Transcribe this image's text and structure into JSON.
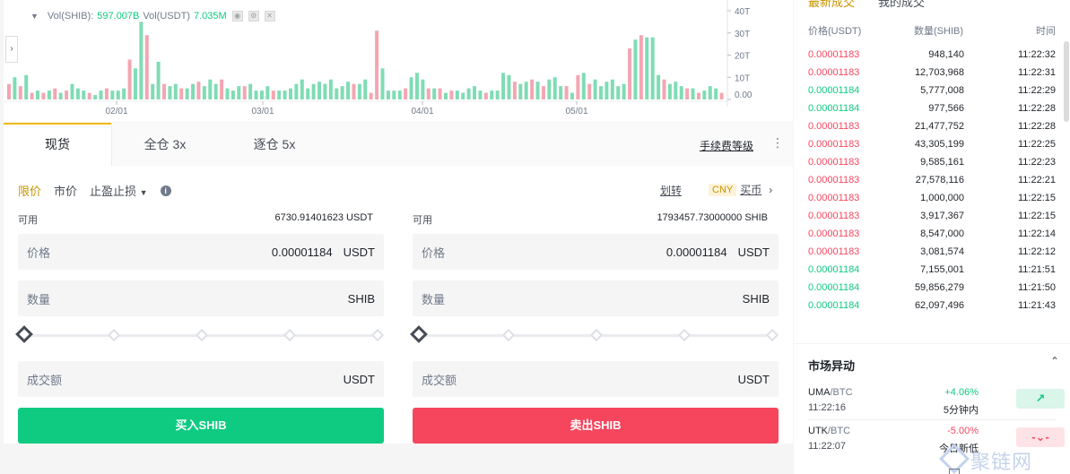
{
  "chart": {
    "legend_vol_shib_label": "Vol(SHIB):",
    "legend_vol_shib_value": "597.007B",
    "legend_vol_usdt_label": "Vol(USDT)",
    "legend_vol_usdt_value": "7.035M",
    "y_ticks": [
      "40T",
      "30T",
      "20T",
      "10T",
      "0.00"
    ],
    "x_ticks": [
      "02/01",
      "03/01",
      "04/01",
      "05/01"
    ],
    "colors": {
      "up": "#0ecb81",
      "down": "#f6465d",
      "up_bar": "#7fdcb4",
      "down_bar": "#f3a6b1"
    }
  },
  "chart_data": {
    "type": "bar",
    "ylim": [
      0,
      40
    ],
    "y_unit": "T",
    "x_ticks": [
      "02/01",
      "03/01",
      "04/01",
      "05/01"
    ],
    "values": [
      {
        "v": 7,
        "d": "down"
      },
      {
        "v": 10,
        "d": "up"
      },
      {
        "v": 6,
        "d": "down"
      },
      {
        "v": 11,
        "d": "up"
      },
      {
        "v": 3,
        "d": "down"
      },
      {
        "v": 4,
        "d": "up"
      },
      {
        "v": 3,
        "d": "down"
      },
      {
        "v": 4,
        "d": "up"
      },
      {
        "v": 5,
        "d": "down"
      },
      {
        "v": 3,
        "d": "up"
      },
      {
        "v": 4,
        "d": "down"
      },
      {
        "v": 7,
        "d": "up"
      },
      {
        "v": 5,
        "d": "up"
      },
      {
        "v": 4,
        "d": "up"
      },
      {
        "v": 3,
        "d": "down"
      },
      {
        "v": 2,
        "d": "up"
      },
      {
        "v": 4,
        "d": "up"
      },
      {
        "v": 5,
        "d": "down"
      },
      {
        "v": 4,
        "d": "up"
      },
      {
        "v": 4,
        "d": "up"
      },
      {
        "v": 5,
        "d": "up"
      },
      {
        "v": 18,
        "d": "down"
      },
      {
        "v": 14,
        "d": "up"
      },
      {
        "v": 35,
        "d": "up"
      },
      {
        "v": 29,
        "d": "down"
      },
      {
        "v": 7,
        "d": "up"
      },
      {
        "v": 17,
        "d": "up"
      },
      {
        "v": 7,
        "d": "down"
      },
      {
        "v": 6,
        "d": "up"
      },
      {
        "v": 7,
        "d": "up"
      },
      {
        "v": 5,
        "d": "down"
      },
      {
        "v": 5,
        "d": "up"
      },
      {
        "v": 7,
        "d": "up"
      },
      {
        "v": 8,
        "d": "down"
      },
      {
        "v": 6,
        "d": "up"
      },
      {
        "v": 9,
        "d": "up"
      },
      {
        "v": 7,
        "d": "up"
      },
      {
        "v": 9,
        "d": "down"
      },
      {
        "v": 5,
        "d": "up"
      },
      {
        "v": 4,
        "d": "up"
      },
      {
        "v": 6,
        "d": "up"
      },
      {
        "v": 6,
        "d": "down"
      },
      {
        "v": 7,
        "d": "up"
      },
      {
        "v": 4,
        "d": "up"
      },
      {
        "v": 4,
        "d": "up"
      },
      {
        "v": 6,
        "d": "up"
      },
      {
        "v": 4,
        "d": "down"
      },
      {
        "v": 4,
        "d": "up"
      },
      {
        "v": 4,
        "d": "up"
      },
      {
        "v": 5,
        "d": "up"
      },
      {
        "v": 7,
        "d": "up"
      },
      {
        "v": 9,
        "d": "up"
      },
      {
        "v": 5,
        "d": "up"
      },
      {
        "v": 7,
        "d": "up"
      },
      {
        "v": 8,
        "d": "up"
      },
      {
        "v": 7,
        "d": "up"
      },
      {
        "v": 9,
        "d": "up"
      },
      {
        "v": 5,
        "d": "up"
      },
      {
        "v": 6,
        "d": "up"
      },
      {
        "v": 8,
        "d": "up"
      },
      {
        "v": 7,
        "d": "down"
      },
      {
        "v": 7,
        "d": "up"
      },
      {
        "v": 9,
        "d": "up"
      },
      {
        "v": 3,
        "d": "down"
      },
      {
        "v": 31,
        "d": "down"
      },
      {
        "v": 14,
        "d": "up"
      },
      {
        "v": 4,
        "d": "up"
      },
      {
        "v": 4,
        "d": "up"
      },
      {
        "v": 4,
        "d": "up"
      },
      {
        "v": 5,
        "d": "down"
      },
      {
        "v": 10,
        "d": "up"
      },
      {
        "v": 12,
        "d": "up"
      },
      {
        "v": 9,
        "d": "up"
      },
      {
        "v": 5,
        "d": "down"
      },
      {
        "v": 5,
        "d": "up"
      },
      {
        "v": 5,
        "d": "down"
      },
      {
        "v": 3,
        "d": "up"
      },
      {
        "v": 4,
        "d": "down"
      },
      {
        "v": 4,
        "d": "up"
      },
      {
        "v": 3,
        "d": "up"
      },
      {
        "v": 5,
        "d": "up"
      },
      {
        "v": 6,
        "d": "up"
      },
      {
        "v": 4,
        "d": "up"
      },
      {
        "v": 3,
        "d": "down"
      },
      {
        "v": 4,
        "d": "up"
      },
      {
        "v": 4,
        "d": "up"
      },
      {
        "v": 12,
        "d": "up"
      },
      {
        "v": 11,
        "d": "up"
      },
      {
        "v": 8,
        "d": "down"
      },
      {
        "v": 7,
        "d": "up"
      },
      {
        "v": 8,
        "d": "up"
      },
      {
        "v": 9,
        "d": "down"
      },
      {
        "v": 8,
        "d": "up"
      },
      {
        "v": 6,
        "d": "down"
      },
      {
        "v": 9,
        "d": "up"
      },
      {
        "v": 10,
        "d": "up"
      },
      {
        "v": 6,
        "d": "up"
      },
      {
        "v": 6,
        "d": "down"
      },
      {
        "v": 3,
        "d": "up"
      },
      {
        "v": 11,
        "d": "down"
      },
      {
        "v": 12,
        "d": "up"
      },
      {
        "v": 7,
        "d": "down"
      },
      {
        "v": 9,
        "d": "up"
      },
      {
        "v": 6,
        "d": "up"
      },
      {
        "v": 8,
        "d": "up"
      },
      {
        "v": 9,
        "d": "up"
      },
      {
        "v": 6,
        "d": "up"
      },
      {
        "v": 7,
        "d": "up"
      },
      {
        "v": 23,
        "d": "down"
      },
      {
        "v": 27,
        "d": "up"
      },
      {
        "v": 29,
        "d": "down"
      },
      {
        "v": 28,
        "d": "up"
      },
      {
        "v": 28,
        "d": "up"
      },
      {
        "v": 11,
        "d": "up"
      },
      {
        "v": 9,
        "d": "down"
      },
      {
        "v": 7,
        "d": "up"
      },
      {
        "v": 8,
        "d": "up"
      },
      {
        "v": 6,
        "d": "up"
      },
      {
        "v": 5,
        "d": "down"
      },
      {
        "v": 5,
        "d": "up"
      },
      {
        "v": 3,
        "d": "down"
      },
      {
        "v": 4,
        "d": "up"
      },
      {
        "v": 6,
        "d": "up"
      },
      {
        "v": 5,
        "d": "up"
      },
      {
        "v": 3,
        "d": "down"
      }
    ]
  },
  "order": {
    "tabs": [
      "现货",
      "全仓 3x",
      "逐仓 5x"
    ],
    "fee_link": "手续费等级",
    "types": [
      "限价",
      "市价",
      "止盈止损"
    ],
    "transfer": "划转",
    "cny_badge": "CNY",
    "buy_coin": "买币",
    "buy": {
      "avail_label": "可用",
      "avail_value": "6730.91401623 USDT",
      "price_label": "价格",
      "price_value": "0.00001184",
      "price_unit": "USDT",
      "qty_label": "数量",
      "qty_unit": "SHIB",
      "slider_percent": 0,
      "total_label": "成交额",
      "total_unit": "USDT",
      "button": "买入SHIB"
    },
    "sell": {
      "avail_label": "可用",
      "avail_value": "1793457.73000000 SHIB",
      "price_label": "价格",
      "price_value": "0.00001184",
      "price_unit": "USDT",
      "qty_label": "数量",
      "qty_unit": "SHIB",
      "slider_percent": 0,
      "total_label": "成交额",
      "total_unit": "USDT",
      "button": "卖出SHIB"
    }
  },
  "trades": {
    "tab_latest": "最新成交",
    "tab_mine": "我的成交",
    "col_price": "价格(USDT)",
    "col_qty": "数量(SHIB)",
    "col_time": "时间",
    "rows": [
      {
        "price": "0.00001183",
        "qty": "948,140",
        "time": "11:22:32",
        "side": "sell"
      },
      {
        "price": "0.00001183",
        "qty": "12,703,968",
        "time": "11:22:31",
        "side": "sell"
      },
      {
        "price": "0.00001184",
        "qty": "5,777,008",
        "time": "11:22:29",
        "side": "buy"
      },
      {
        "price": "0.00001184",
        "qty": "977,566",
        "time": "11:22:28",
        "side": "buy"
      },
      {
        "price": "0.00001183",
        "qty": "21,477,752",
        "time": "11:22:28",
        "side": "sell"
      },
      {
        "price": "0.00001183",
        "qty": "43,305,199",
        "time": "11:22:25",
        "side": "sell"
      },
      {
        "price": "0.00001183",
        "qty": "9,585,161",
        "time": "11:22:23",
        "side": "sell"
      },
      {
        "price": "0.00001183",
        "qty": "27,578,116",
        "time": "11:22:21",
        "side": "sell"
      },
      {
        "price": "0.00001183",
        "qty": "1,000,000",
        "time": "11:22:15",
        "side": "sell"
      },
      {
        "price": "0.00001183",
        "qty": "3,917,367",
        "time": "11:22:15",
        "side": "sell"
      },
      {
        "price": "0.00001183",
        "qty": "8,547,000",
        "time": "11:22:14",
        "side": "sell"
      },
      {
        "price": "0.00001183",
        "qty": "3,081,574",
        "time": "11:22:12",
        "side": "sell"
      },
      {
        "price": "0.00001184",
        "qty": "7,155,001",
        "time": "11:21:51",
        "side": "buy"
      },
      {
        "price": "0.00001184",
        "qty": "59,856,279",
        "time": "11:21:50",
        "side": "buy"
      },
      {
        "price": "0.00001184",
        "qty": "62,097,496",
        "time": "11:21:43",
        "side": "buy"
      }
    ]
  },
  "movers": {
    "title": "市场异动",
    "items": [
      {
        "base": "UMA",
        "quote": "/BTC",
        "time": "11:22:16",
        "change": "+4.06%",
        "desc": "5分钟内",
        "dir": "up"
      },
      {
        "base": "UTK",
        "quote": "/BTC",
        "time": "11:22:07",
        "change": "-5.00%",
        "desc": "今日新低",
        "dir": "down"
      }
    ]
  },
  "watermark": "聚链网"
}
